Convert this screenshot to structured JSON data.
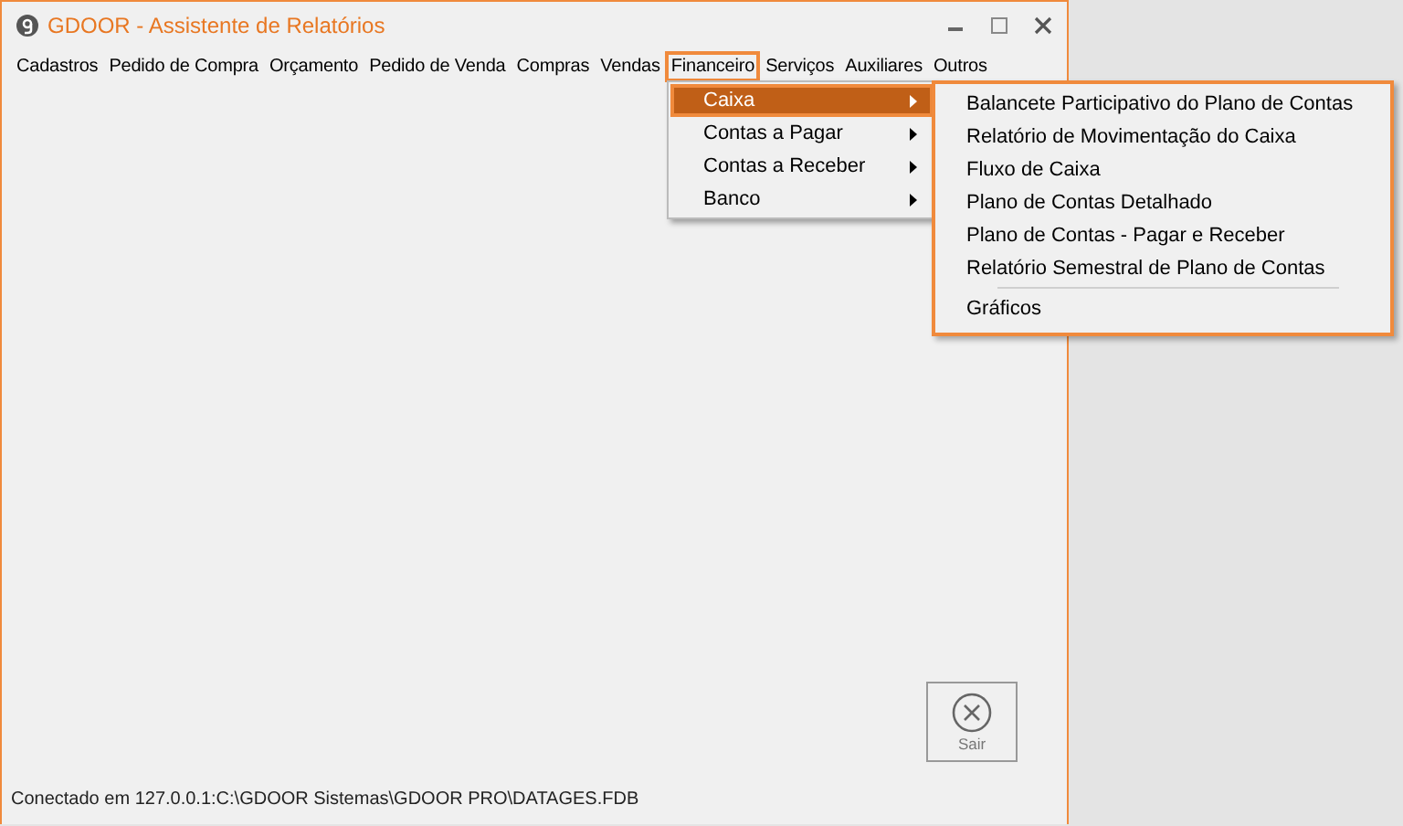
{
  "window": {
    "title": "GDOOR - Assistente de Relatórios"
  },
  "menu_bar": [
    {
      "label": "Cadastros",
      "selected": false
    },
    {
      "label": "Pedido de Compra",
      "selected": false
    },
    {
      "label": "Orçamento",
      "selected": false
    },
    {
      "label": "Pedido de Venda",
      "selected": false
    },
    {
      "label": "Compras",
      "selected": false
    },
    {
      "label": "Vendas",
      "selected": false
    },
    {
      "label": "Financeiro",
      "selected": true
    },
    {
      "label": "Serviços",
      "selected": false
    },
    {
      "label": "Auxiliares",
      "selected": false
    },
    {
      "label": "Outros",
      "selected": false
    }
  ],
  "dropdown": [
    {
      "label": "Caixa",
      "selected": true
    },
    {
      "label": "Contas a Pagar",
      "selected": false
    },
    {
      "label": "Contas a Receber",
      "selected": false
    },
    {
      "label": "Banco",
      "selected": false
    }
  ],
  "submenu": [
    {
      "kind": "item",
      "label": "Balancete Participativo do Plano de Contas"
    },
    {
      "kind": "item",
      "label": "Relatório de Movimentação do Caixa"
    },
    {
      "kind": "item",
      "label": "Fluxo de Caixa"
    },
    {
      "kind": "item",
      "label": "Plano de Contas Detalhado"
    },
    {
      "kind": "item",
      "label": "Plano de Contas - Pagar e Receber"
    },
    {
      "kind": "item",
      "label": "Relatório Semestral de Plano de Contas"
    },
    {
      "kind": "separator"
    },
    {
      "kind": "item",
      "label": "Gráficos"
    }
  ],
  "exit_button": {
    "label": "Sair"
  },
  "status_bar": "Conectado em 127.0.0.1:C:\\GDOOR Sistemas\\GDOOR PRO\\DATAGES.FDB"
}
